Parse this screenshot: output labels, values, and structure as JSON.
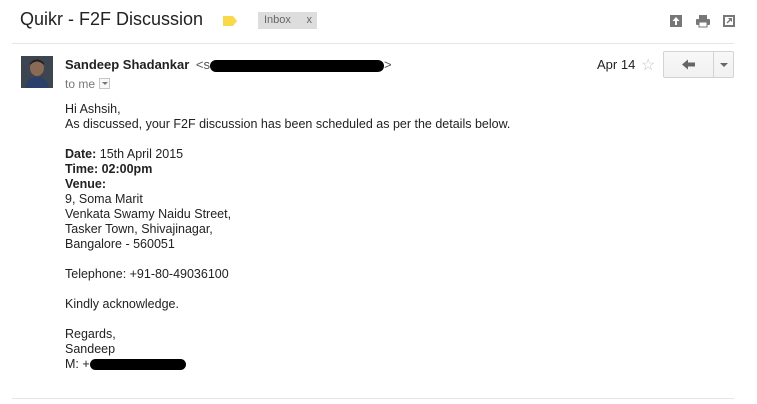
{
  "email": {
    "subject": "Quikr - F2F Discussion",
    "label_chip": "Inbox",
    "label_chip_close": "x",
    "label_color": "#f9d84c",
    "sender_name": "Sandeep Shadankar",
    "sender_email_open": "<s",
    "sender_email_close": ">",
    "to_label": "to me",
    "date": "Apr 14",
    "star": "☆"
  },
  "body": {
    "greeting": "Hi Ashsih,",
    "intro": "As discussed, your F2F discussion has been scheduled as per the details below.",
    "date_label": "Date:",
    "date_value": " 15th April 2015",
    "time_label": "Time: 02:00pm",
    "venue_label": "Venue:",
    "address": [
      "9, Soma Marit",
      "Venkata Swamy Naidu Street,",
      "Tasker Town, Shivajinagar,",
      "Bangalore - 560051"
    ],
    "telephone": "Telephone: +91-80-49036100",
    "ack": "Kindly acknowledge.",
    "regards": "Regards,",
    "signature": "Sandeep",
    "mobile_prefix": "M: +"
  },
  "icons": {
    "archive": "archive-icon",
    "print": "print-icon",
    "new_window": "new-window-icon",
    "reply": "reply-icon",
    "more": "chevron-down-icon"
  }
}
